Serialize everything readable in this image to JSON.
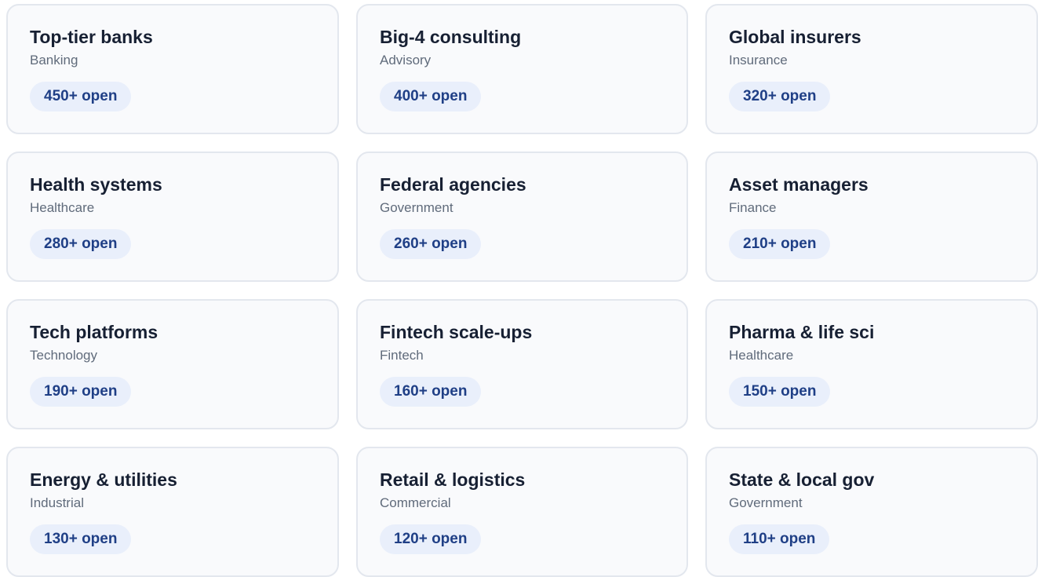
{
  "cards": [
    {
      "title": "Top-tier banks",
      "category": "Banking",
      "openings": "450+ open"
    },
    {
      "title": "Big-4 consulting",
      "category": "Advisory",
      "openings": "400+ open"
    },
    {
      "title": "Global insurers",
      "category": "Insurance",
      "openings": "320+ open"
    },
    {
      "title": "Health systems",
      "category": "Healthcare",
      "openings": "280+ open"
    },
    {
      "title": "Federal agencies",
      "category": "Government",
      "openings": "260+ open"
    },
    {
      "title": "Asset managers",
      "category": "Finance",
      "openings": "210+ open"
    },
    {
      "title": "Tech platforms",
      "category": "Technology",
      "openings": "190+ open"
    },
    {
      "title": "Fintech scale-ups",
      "category": "Fintech",
      "openings": "160+ open"
    },
    {
      "title": "Pharma & life sci",
      "category": "Healthcare",
      "openings": "150+ open"
    },
    {
      "title": "Energy & utilities",
      "category": "Industrial",
      "openings": "130+ open"
    },
    {
      "title": "Retail & logistics",
      "category": "Commercial",
      "openings": "120+ open"
    },
    {
      "title": "State & local gov",
      "category": "Government",
      "openings": "110+ open"
    }
  ]
}
